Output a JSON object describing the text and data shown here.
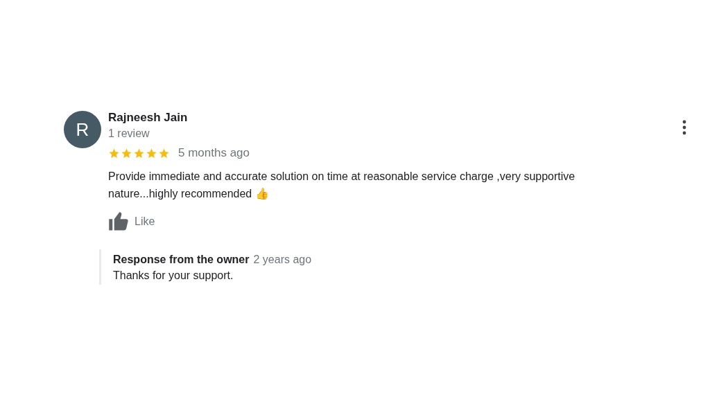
{
  "review": {
    "avatar_letter": "R",
    "author": "Rajneesh Jain",
    "review_count": "1 review",
    "stars": 5,
    "time": "5 months ago",
    "text": "Provide immediate and accurate solution on time at reasonable service charge ,very supportive nature...highly recommended 👍",
    "like_label": "Like",
    "owner_response": {
      "title": "Response from the owner",
      "time": "2 years ago",
      "text": "Thanks for your support."
    }
  }
}
